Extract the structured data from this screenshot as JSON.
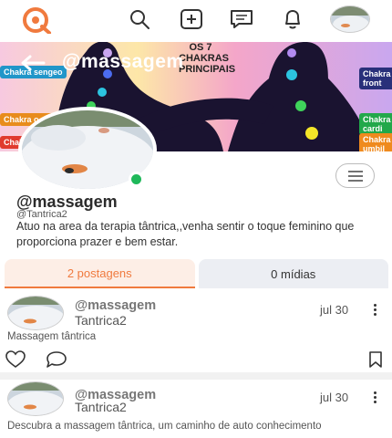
{
  "topnav": {
    "icons": [
      "logo-icon",
      "search-icon",
      "add-post-icon",
      "chat-icon",
      "bell-icon",
      "user-avatar"
    ],
    "accent": "#f07a3e"
  },
  "cover": {
    "title": "@massagem",
    "image_heading": "OS 7 CHAKRAS PRINCIPAIS",
    "left_chips": [
      "Chakra sengeo",
      "Chakra o solar",
      "Chakra sico"
    ],
    "right_chips": [
      "Chakra front",
      "Chakra cardi",
      "Chakra umbil"
    ]
  },
  "profile": {
    "name": "@massagem",
    "handle": "@Tantrica2",
    "bio": "Atuo na area da terapia tântrica,,venha sentir o toque feminino que proporciona prazer e bem estar.",
    "status_color": "#1fb85a"
  },
  "tabs": [
    {
      "label": "2 postagens",
      "active": true
    },
    {
      "label": "0 mídias",
      "active": false
    }
  ],
  "posts": [
    {
      "user": "@massagem",
      "subtitle": "Tantrica2",
      "date": "jul 30",
      "text": "Massagem tântrica"
    },
    {
      "user": "@massagem",
      "subtitle": "Tantrica2",
      "date": "jul 30",
      "text": "Descubra a massagem tântrica, um caminho de auto conhecimento"
    }
  ]
}
